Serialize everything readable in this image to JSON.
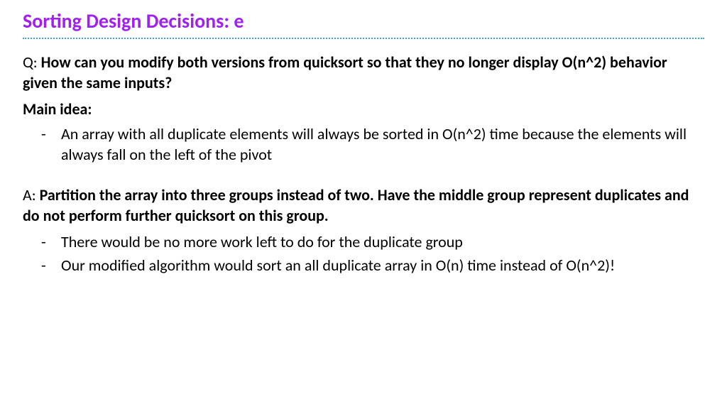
{
  "title": "Sorting Design Decisions: e",
  "question_prefix": "Q: ",
  "question_text": "How can you modify both versions from quicksort so that they no longer display O(n^2) behavior given the same inputs?",
  "main_idea_label": "Main idea:",
  "main_idea_bullets": [
    "An array with all duplicate elements will always be sorted in O(n^2) time because the elements will always fall on the left of the pivot"
  ],
  "answer_prefix": "A: ",
  "answer_text": "Partition the array into three groups instead of two. Have the middle group represent duplicates and do not perform further quicksort on this group.",
  "answer_bullets": [
    "There would be no more work left to do for the duplicate group",
    "Our modified algorithm would sort an all duplicate array in O(n) time instead of O(n^2)!"
  ]
}
